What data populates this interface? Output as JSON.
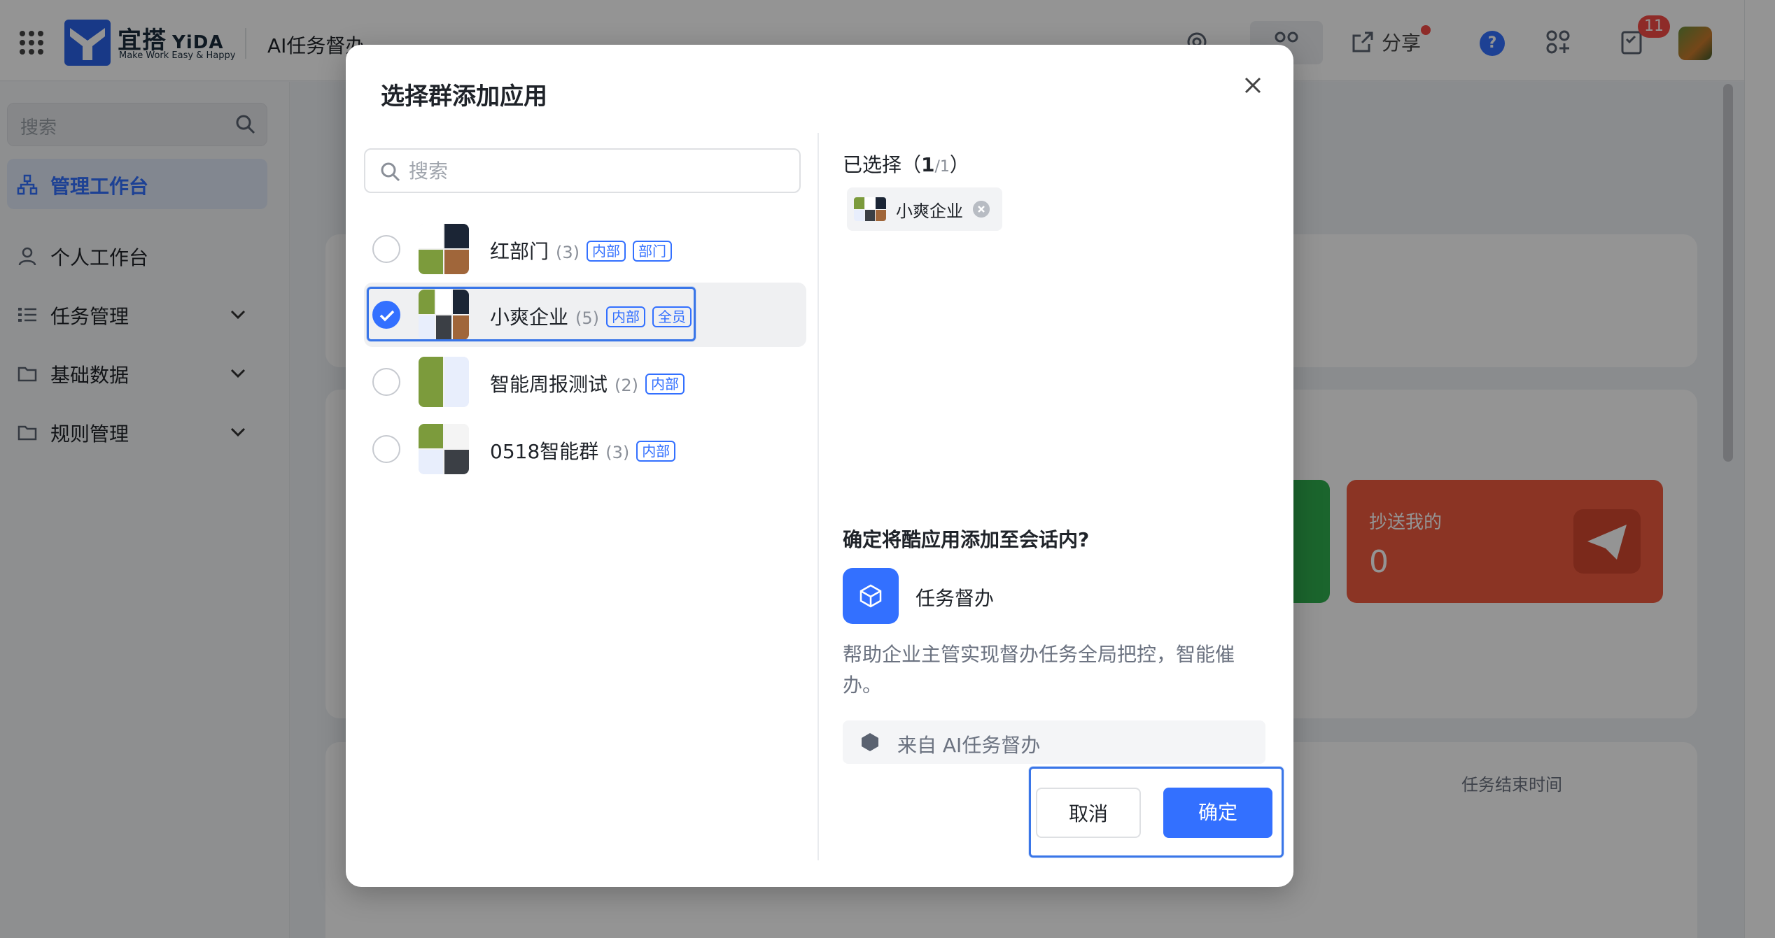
{
  "topbar": {
    "logo_main": "宜搭",
    "logo_yida": "YiDA",
    "logo_sub": "Make Work Easy & Happy",
    "app_title": "AI任务督办",
    "share_label": "分享",
    "help_label": "?",
    "notification_count": "11"
  },
  "sidebar": {
    "search_placeholder": "搜索",
    "items": [
      {
        "label": "管理工作台",
        "icon": "org-icon",
        "active": true
      },
      {
        "label": "个人工作台",
        "icon": "user-icon"
      },
      {
        "label": "任务管理",
        "icon": "list-icon",
        "expandable": true
      },
      {
        "label": "基础数据",
        "icon": "folder-icon",
        "expandable": true
      },
      {
        "label": "规则管理",
        "icon": "folder-icon",
        "expandable": true
      }
    ]
  },
  "background": {
    "stat_card_label": "抄送我的",
    "stat_card_value": "0",
    "column_header": "任务结束时间"
  },
  "modal": {
    "title": "选择群添加应用",
    "search_placeholder": "搜索",
    "groups": [
      {
        "name": "红部门",
        "count": "(3)",
        "tags": [
          "内部",
          "部门"
        ],
        "checked": false
      },
      {
        "name": "小爽企业",
        "count": "(5)",
        "tags": [
          "内部",
          "全员"
        ],
        "checked": true
      },
      {
        "name": "智能周报测试",
        "count": "(2)",
        "tags": [
          "内部"
        ],
        "checked": false
      },
      {
        "name": "0518智能群",
        "count": "(3)",
        "tags": [
          "内部"
        ],
        "checked": false
      }
    ],
    "selected_label": "已选择（",
    "selected_count": "1",
    "selected_total": "/1",
    "selected_close": "）",
    "selected_items": [
      {
        "name": "小爽企业"
      }
    ],
    "confirm_question": "确定将酷应用添加至会话内?",
    "app_name": "任务督办",
    "app_description": "帮助企业主管实现督办任务全局把控，智能催办。",
    "app_source": "来自 AI任务督办",
    "cancel_label": "取消",
    "ok_label": "确定"
  },
  "colors": {
    "accent": "#3370ff",
    "highlight_outline": "#3a76e8",
    "danger": "#f54a45",
    "stat_red": "#f05a3e",
    "stat_green": "#2fae4e"
  }
}
